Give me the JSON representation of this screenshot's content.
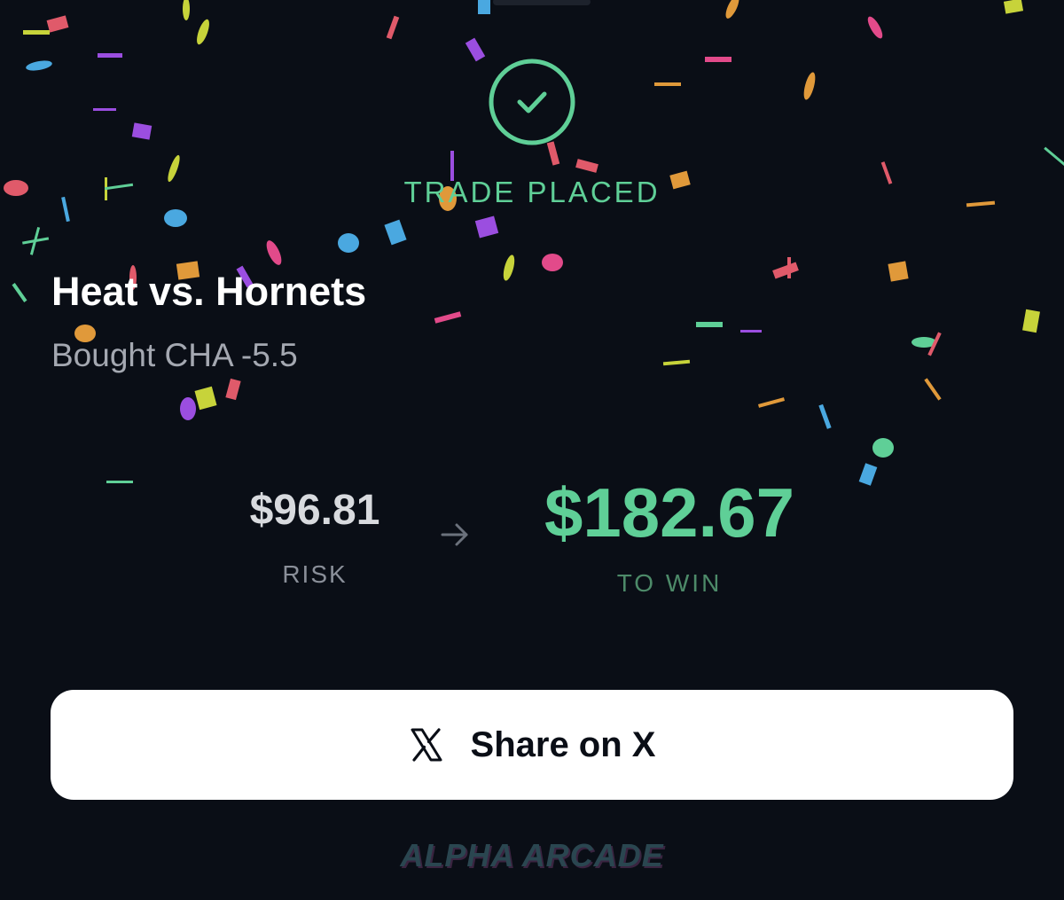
{
  "status": {
    "title": "TRADE PLACED",
    "icon": "check-circle-icon",
    "accent_color": "#5fcf97"
  },
  "trade": {
    "event": "Heat vs. Hornets",
    "description": "Bought CHA -5.5"
  },
  "payout": {
    "risk_amount": "$96.81",
    "risk_label": "RISK",
    "win_amount": "$182.67",
    "win_label": "TO WIN",
    "arrow_icon": "arrow-right-icon"
  },
  "share": {
    "label": "Share on X",
    "icon": "x-logo-icon"
  },
  "brand": {
    "name": "ALPHA ARCADE"
  },
  "confetti_colors": [
    "#e24a8a",
    "#c7d33a",
    "#4aa8e0",
    "#9b4ee0",
    "#e0993a",
    "#5fcf97",
    "#e05a6a"
  ]
}
